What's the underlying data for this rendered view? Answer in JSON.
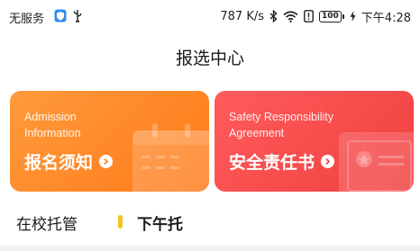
{
  "status_bar": {
    "carrier": "无服务",
    "speed": "787 K/s",
    "battery": "100",
    "time": "下午4:28",
    "icons": [
      "shield-icon",
      "usb-icon",
      "bluetooth-icon",
      "wifi-icon",
      "alert-icon",
      "battery-icon",
      "charging-icon"
    ]
  },
  "header": {
    "title": "报选中心"
  },
  "cards": [
    {
      "english_line1": "Admission",
      "english_line2": "Information",
      "label": "报名须知",
      "color": "#ff8a25",
      "icon": "calendar-icon"
    },
    {
      "english_line1": "Safety Responsibility",
      "english_line2": "Agreement",
      "label": "安全责任书",
      "color": "#f44c4b",
      "icon": "certificate-icon"
    }
  ],
  "tabs": [
    {
      "label": "在校托管"
    },
    {
      "label": "下午托",
      "selected": true,
      "marker_color": "#f7c21b"
    }
  ]
}
